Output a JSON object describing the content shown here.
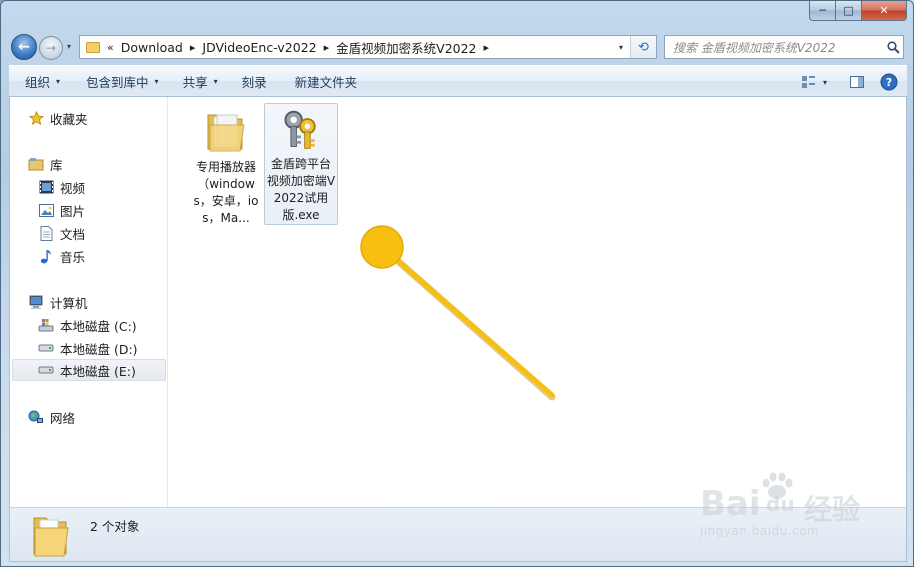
{
  "window": {
    "caption": {
      "minimize": "─",
      "maximize": "□",
      "close": "✕"
    }
  },
  "nav": {
    "back_icon": "back-arrow-icon",
    "forward_icon": "forward-arrow-icon",
    "history_arrow": "▾",
    "breadcrumbs": [
      "Download",
      "JDVideoEnc-v2022",
      "金盾视频加密系统V2022"
    ],
    "overflow": "«",
    "separator": "▸",
    "dropdown": "▾",
    "refresh": "⟲"
  },
  "search": {
    "placeholder": "搜索 金盾视频加密系统V2022"
  },
  "toolbar": {
    "organize": "组织",
    "include_library": "包含到库中",
    "share": "共享",
    "burn": "刻录",
    "new_folder": "新建文件夹",
    "arrow": "▾"
  },
  "nav_pane": {
    "favorites": "收藏夹",
    "libraries": "库",
    "videos": "视频",
    "pictures": "图片",
    "documents": "文档",
    "music": "音乐",
    "computer": "计算机",
    "drive_c": "本地磁盘 (C:)",
    "drive_d": "本地磁盘 (D:)",
    "drive_e": "本地磁盘 (E:)",
    "network": "网络"
  },
  "files": [
    {
      "name": "专用播放器（windows，安卓，ios，Ma...",
      "type": "folder"
    },
    {
      "name": "金盾跨平台视频加密端V2022试用版.exe",
      "type": "application"
    }
  ],
  "status": {
    "count": "2 个对象"
  },
  "watermark": {
    "brand_1": "Bai",
    "brand_2": "du",
    "brand_3": "经验",
    "url": "jingyan.baidu.com"
  },
  "colors": {
    "pointer": "#f7bf12",
    "accent": "#3b78c2"
  }
}
